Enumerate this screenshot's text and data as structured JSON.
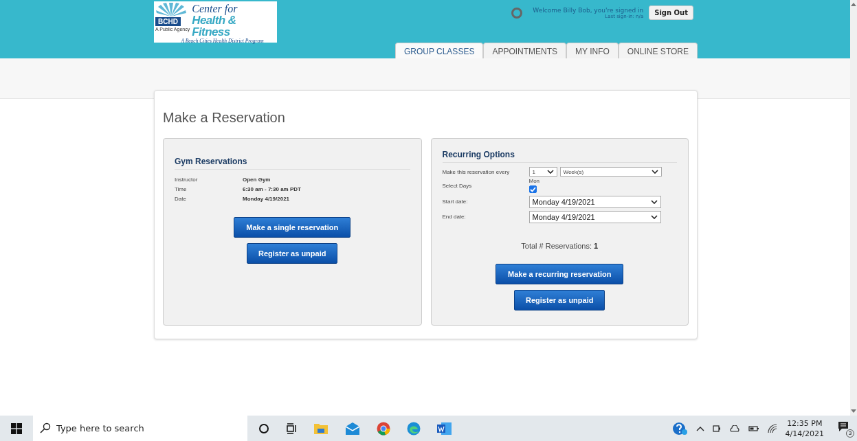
{
  "logo": {
    "badge": "BCHD",
    "agency": "A Public Agency",
    "line_1": "Center for",
    "line_2": "Health & Fitness",
    "tagline": "A Beach Cities Health District Program"
  },
  "user": {
    "welcome": "Welcome Billy Bob, you're signed in",
    "last_signin": "Last sign-in: n/a",
    "sign_out": "Sign Out"
  },
  "tabs": [
    {
      "label": "GROUP CLASSES",
      "selected": true
    },
    {
      "label": "APPOINTMENTS",
      "selected": false
    },
    {
      "label": "MY INFO",
      "selected": false
    },
    {
      "label": "ONLINE STORE",
      "selected": false
    }
  ],
  "page_title": "Make a Reservation",
  "gym": {
    "title": "Gym Reservations",
    "details": [
      {
        "label": "Instructor",
        "value": "Open Gym"
      },
      {
        "label": "Time",
        "value": "6:30 am - 7:30 am  PDT"
      },
      {
        "label": "Date",
        "value": "Monday 4/19/2021"
      }
    ],
    "buttons": [
      "Make a single reservation",
      "Register as unpaid"
    ]
  },
  "recurring": {
    "title": "Recurring Options",
    "every_label": "Make this reservation every",
    "every_count": "1",
    "every_unit": "Week(s)",
    "days_label": "Select Days",
    "days": [
      {
        "label": "Mon",
        "checked": true
      }
    ],
    "start_label": "Start date:",
    "start_value": "Monday 4/19/2021",
    "end_label": "End date:",
    "end_value": "Monday 4/19/2021",
    "total_label": "Total # Reservations:",
    "total_value": "1",
    "buttons": [
      "Make a recurring reservation",
      "Register as unpaid"
    ]
  },
  "taskbar": {
    "search_placeholder": "Type here to search",
    "time": "12:35 PM",
    "date": "4/14/2021",
    "notifications": "3"
  }
}
